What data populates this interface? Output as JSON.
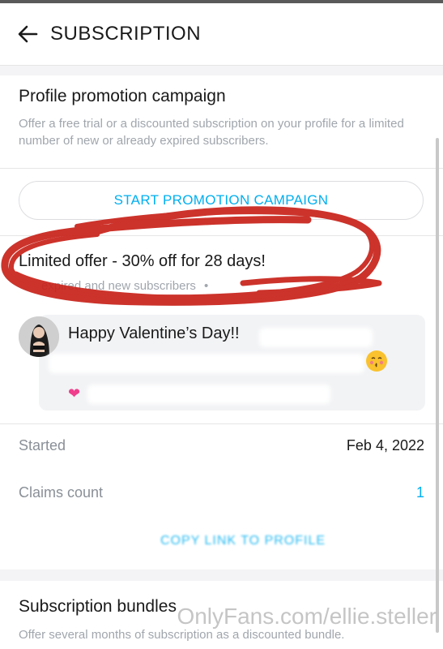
{
  "header": {
    "title": "SUBSCRIPTION"
  },
  "promotion": {
    "title": "Profile promotion campaign",
    "description": "Offer a free trial or a discounted subscription on your profile for a limited number of new or already expired subscribers.",
    "start_button_label": "START PROMOTION CAMPAIGN"
  },
  "campaign": {
    "offer_title": "Limited offer - 30% off for 28 days!",
    "offer_subtitle": "expired and new subscribers",
    "message_text": "Happy Valentine’s Day!!",
    "started_label": "Started",
    "started_value": "Feb 4, 2022",
    "claims_label": "Claims count",
    "claims_value": "1",
    "copy_link_label": "COPY LINK TO PROFILE"
  },
  "bundles": {
    "title": "Subscription bundles",
    "description": "Offer several months of subscription as a discounted bundle."
  },
  "watermark": "OnlyFans.com/ellie.steller",
  "colors": {
    "accent": "#00aff0",
    "scribble": "#c8221a",
    "muted_text": "#a0a6ad"
  },
  "icons": {
    "back": "arrow-left-icon",
    "emoji": "kissing-face-icon",
    "heart": "heart-icon"
  }
}
